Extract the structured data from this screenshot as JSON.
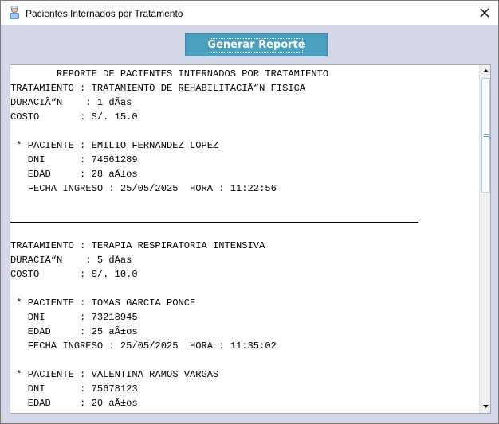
{
  "window": {
    "title": "Pacientes Internados por Tratamento",
    "icons": {
      "app": "patient-icon",
      "close": "close-icon"
    }
  },
  "toolbar": {
    "generate_label": "Generar Reporte"
  },
  "report": {
    "lines": [
      "        REPORTE DE PACIENTES INTERNADOS POR TRATAMIENTO",
      "TRATAMIENTO : TRATAMIENTO DE REHABILITACIÃ“N FISICA",
      "DURACIÃ“N    : 1 dÃ­as",
      "COSTO       : S/. 15.0",
      "",
      " * PACIENTE : EMILIO FERNANDEZ LOPEZ",
      "   DNI      : 74561289",
      "   EDAD     : 28 aÃ±os",
      "   FECHA INGRESO : 25/05/2025  HORA : 11:22:56",
      "",
      "",
      "",
      "TRATAMIENTO : TERAPIA RESPIRATORIA INTENSIVA",
      "DURACIÃ“N    : 5 dÃ­as",
      "COSTO       : S/. 10.0",
      "",
      " * PACIENTE : TOMAS GARCIA PONCE",
      "   DNI      : 73218945",
      "   EDAD     : 25 aÃ±os",
      "   FECHA INGRESO : 25/05/2025  HORA : 11:35:02",
      "",
      " * PACIENTE : VALENTINA RAMOS VARGAS",
      "   DNI      : 75678123",
      "   EDAD     : 20 aÃ±os"
    ]
  },
  "scrollbar": {
    "position": 0.0,
    "visible_fraction": 0.33
  }
}
